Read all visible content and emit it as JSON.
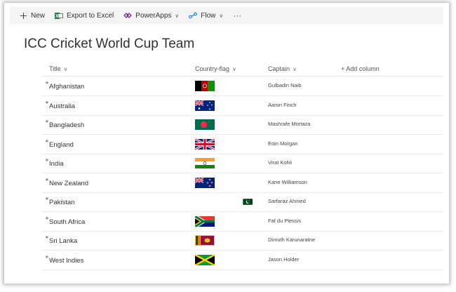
{
  "toolbar": {
    "new_label": "New",
    "export_label": "Export to Excel",
    "powerapps_label": "PowerApps",
    "flow_label": "Flow",
    "more_label": "···"
  },
  "page": {
    "title": "ICC Cricket World Cup Team"
  },
  "columns": {
    "title": "Title",
    "flag": "Country-flag",
    "captain": "Captain",
    "add": "+ Add column"
  },
  "rows": [
    {
      "title": "Afghanistan",
      "captain": "Gulbadin Naib",
      "flag": "afghanistan-flag"
    },
    {
      "title": "Australia",
      "captain": "Aaron Finch",
      "flag": "australia-flag"
    },
    {
      "title": "Bangladesh",
      "captain": "Mashrafe Mortaza",
      "flag": "bangladesh-flag"
    },
    {
      "title": "England",
      "captain": "Eoin Morgan",
      "flag": "uk-flag"
    },
    {
      "title": "India",
      "captain": "Virat Kohli",
      "flag": "india-flag"
    },
    {
      "title": "New Zealand",
      "captain": "Kane Williamson",
      "flag": "new-zealand-flag"
    },
    {
      "title": "Pakistan",
      "captain": "Sarfaraz Ahmed",
      "flag": "pakistan-flag"
    },
    {
      "title": "South Africa",
      "captain": "Faf du Plessis",
      "flag": "south-africa-flag"
    },
    {
      "title": "Sri Lanka",
      "captain": "Dimuth Karunaratne",
      "flag": "sri-lanka-flag"
    },
    {
      "title": "West Indies",
      "captain": "Jason Holder",
      "flag": "jamaica-flag"
    }
  ],
  "colors": {
    "accent": "#0078d4",
    "command_bar_bg": "#f4f4f4",
    "text": "#323130"
  }
}
